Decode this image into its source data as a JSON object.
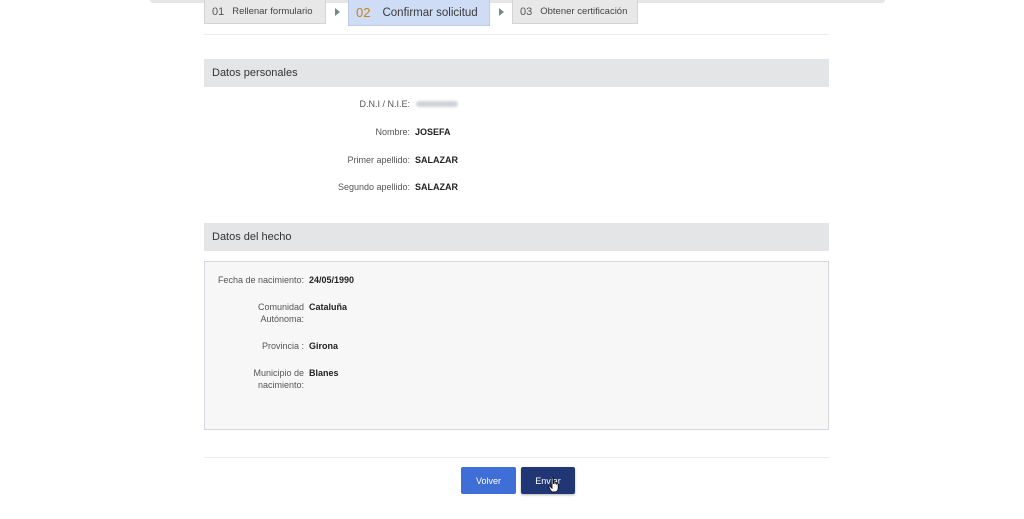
{
  "steps": [
    {
      "num": "01",
      "label": "Rellenar formulario"
    },
    {
      "num": "02",
      "label": "Confirmar solicitud"
    },
    {
      "num": "03",
      "label": "Obtener certificación"
    }
  ],
  "personal": {
    "title": "Datos personales",
    "dni_label": "D.N.I / N.I.E:",
    "dni_value": "",
    "nombre_label": "Nombre:",
    "nombre_value": "JOSEFA",
    "apellido1_label": "Primer apellido:",
    "apellido1_value": "SALAZAR",
    "apellido2_label": "Segundo apellido:",
    "apellido2_value": "SALAZAR"
  },
  "hecho": {
    "title": "Datos del hecho",
    "fecha_label": "Fecha de nacimiento:",
    "fecha_value": "24/05/1990",
    "comunidad_label_1": "Comunidad",
    "comunidad_label_2": "Autónoma:",
    "comunidad_value": "Cataluña",
    "provincia_label": "Provincia :",
    "provincia_value": "Girona",
    "municipio_label_1": "Municipio de",
    "municipio_label_2": "nacimiento:",
    "municipio_value": "Blanes"
  },
  "buttons": {
    "volver": "Volver",
    "enviar": "Enviar"
  },
  "colors": {
    "step_active_bg": "#cfdcf5",
    "step_active_num": "#c9801f",
    "volver_bg": "#3f6fd6",
    "enviar_bg": "#213675",
    "section_bg": "#e3e5e7"
  }
}
